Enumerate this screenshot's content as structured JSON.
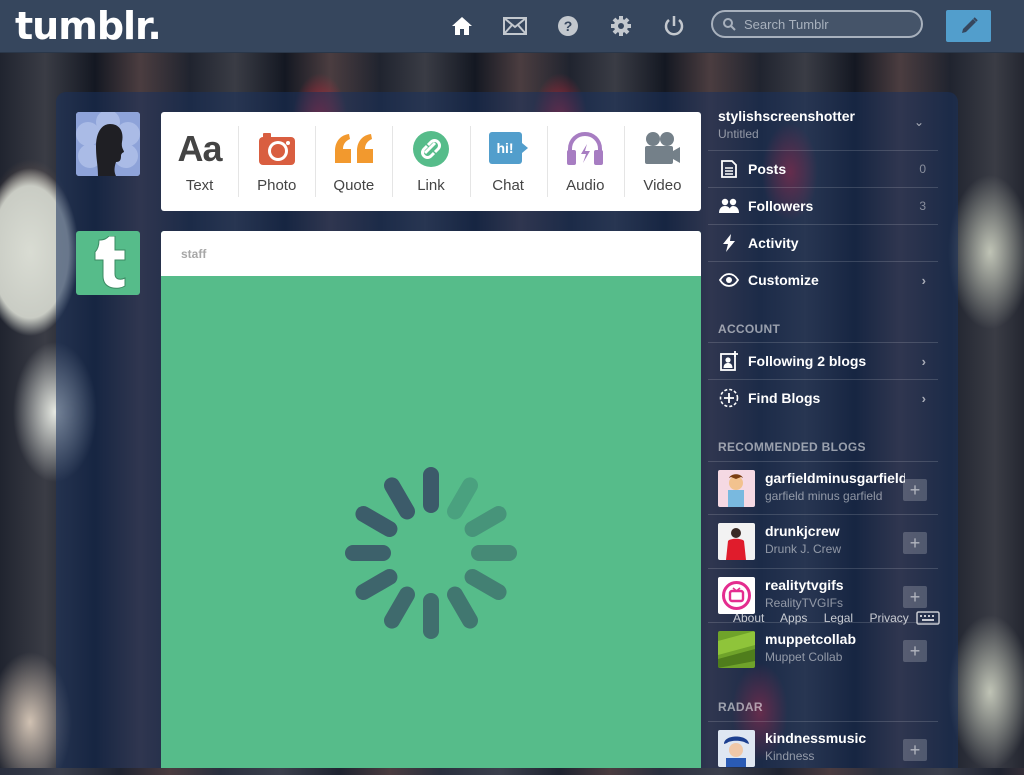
{
  "app": {
    "logo": "tumblr."
  },
  "topbar": {
    "nav": [
      {
        "name": "home-icon",
        "active": true
      },
      {
        "name": "inbox-icon",
        "active": false
      },
      {
        "name": "help-icon",
        "active": false
      },
      {
        "name": "settings-icon",
        "active": false
      },
      {
        "name": "logout-icon",
        "active": false
      }
    ],
    "search_placeholder": "Search Tumblr"
  },
  "post_types": [
    {
      "label": "Text",
      "icon": "text-icon"
    },
    {
      "label": "Photo",
      "icon": "camera-icon"
    },
    {
      "label": "Quote",
      "icon": "quote-icon"
    },
    {
      "label": "Link",
      "icon": "link-icon"
    },
    {
      "label": "Chat",
      "icon": "chat-icon",
      "badge": "hi!"
    },
    {
      "label": "Audio",
      "icon": "headphones-icon"
    },
    {
      "label": "Video",
      "icon": "video-camera-icon"
    }
  ],
  "post": {
    "author": "staff"
  },
  "sidebar": {
    "blog_name": "stylishscreenshotter",
    "blog_sub": "Untitled",
    "items": [
      {
        "label": "Posts",
        "count": "0",
        "icon": "posts-icon"
      },
      {
        "label": "Followers",
        "count": "3",
        "icon": "followers-icon"
      },
      {
        "label": "Activity",
        "icon": "activity-icon"
      },
      {
        "label": "Customize",
        "icon": "eye-icon"
      }
    ],
    "account_label": "ACCOUNT",
    "account_items": [
      {
        "label": "Following 2 blogs",
        "icon": "following-icon"
      },
      {
        "label": "Find Blogs",
        "icon": "find-blogs-icon"
      }
    ],
    "recommended_label": "RECOMMENDED BLOGS",
    "recommended": [
      {
        "name": "garfieldminusgarfield",
        "sub": "garfield minus garfield"
      },
      {
        "name": "drunkjcrew",
        "sub": "Drunk J. Crew"
      },
      {
        "name": "realitytvgifs",
        "sub": "RealityTVGIFs"
      },
      {
        "name": "muppetcollab",
        "sub": "Muppet Collab"
      }
    ],
    "radar_label": "RADAR",
    "radar": [
      {
        "name": "kindnessmusic",
        "sub": "Kindness"
      }
    ],
    "footer": [
      "About",
      "Apps",
      "Legal",
      "Privacy"
    ]
  },
  "colors": {
    "topbar": "#36465d",
    "accent": "#529ecc",
    "staff_green": "#56bc8a",
    "photo": "#d95e40",
    "quote": "#f2992e",
    "link": "#56bc8a",
    "chat": "#529ecc",
    "audio": "#a77dc2",
    "video": "#748089"
  }
}
